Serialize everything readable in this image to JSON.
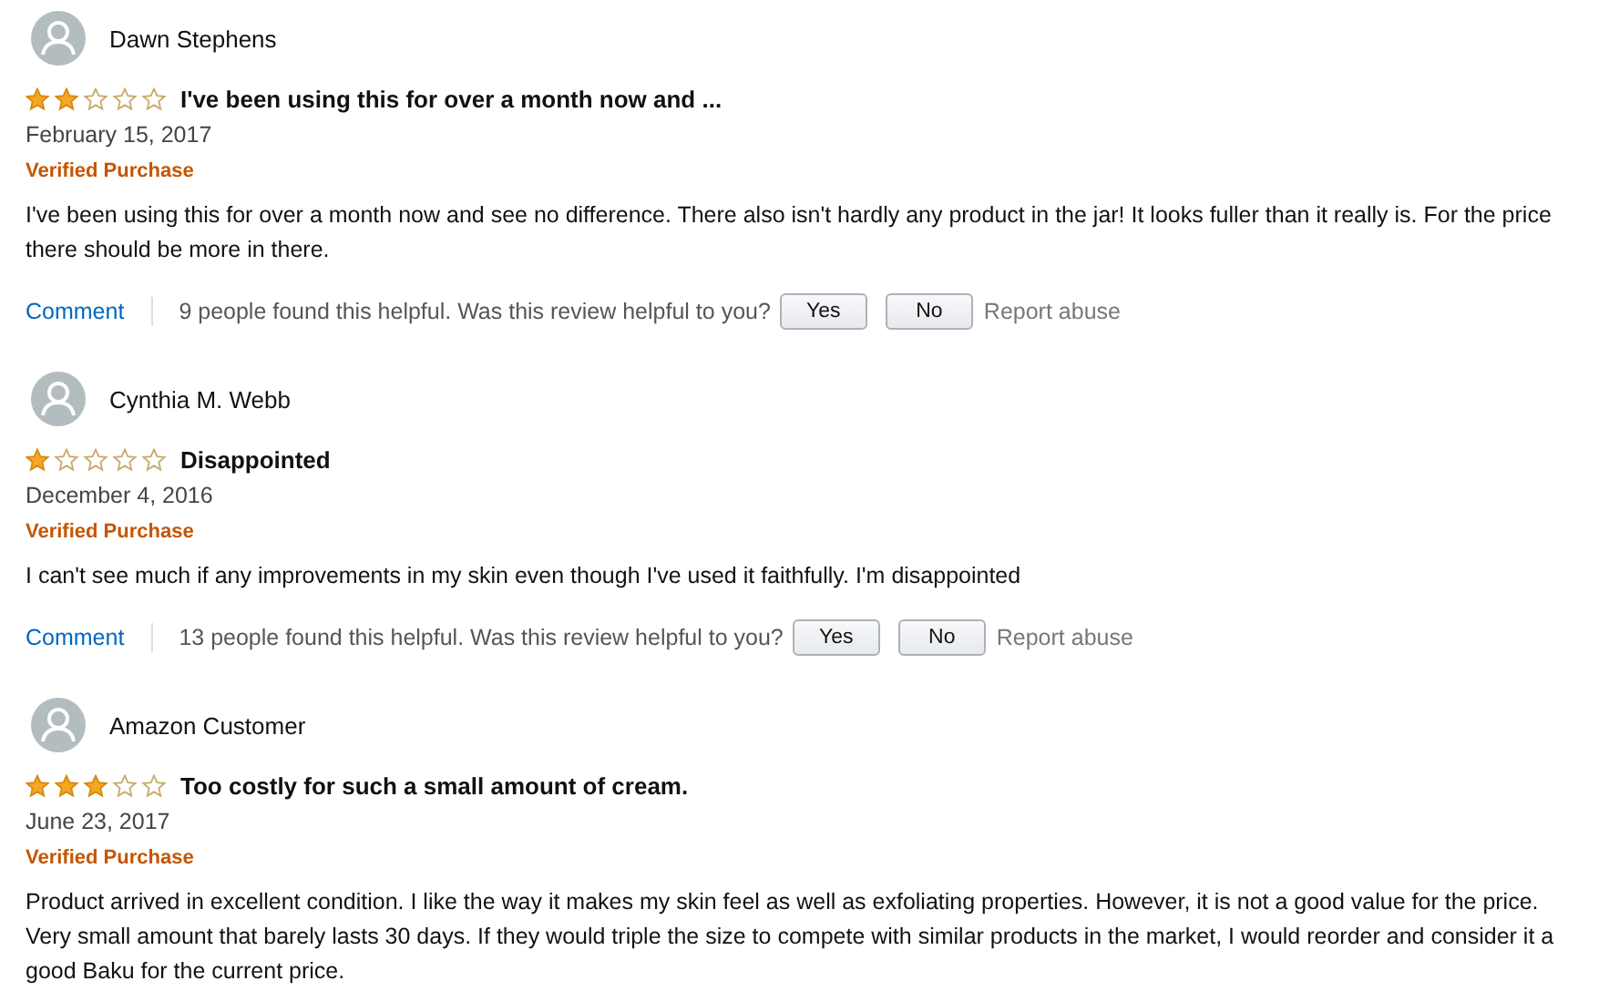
{
  "reviews": [
    {
      "author": "Dawn Stephens",
      "stars": 2,
      "title": "I've been using this for over a month now and ...",
      "date": "February 15, 2017",
      "badge": "Verified Purchase",
      "body": "I've been using this for over a month now and see no difference. There also isn't hardly any product in the jar! It looks fuller than it really is. For the price there should be more in there.",
      "comment": "Comment",
      "helpful": "9 people found this helpful. Was this review helpful to you?",
      "yes": "Yes",
      "no": "No",
      "report": "Report abuse"
    },
    {
      "author": "Cynthia M. Webb",
      "stars": 1,
      "title": "Disappointed",
      "date": "December 4, 2016",
      "badge": "Verified Purchase",
      "body": "I can't see much if any improvements in my skin even though I've used it faithfully. I'm disappointed",
      "comment": "Comment",
      "helpful": "13 people found this helpful. Was this review helpful to you?",
      "yes": "Yes",
      "no": "No",
      "report": "Report abuse"
    },
    {
      "author": "Amazon Customer",
      "stars": 3,
      "title": "Too costly for such a small amount of cream.",
      "date": "June 23, 2017",
      "badge": "Verified Purchase",
      "body": "Product arrived in excellent condition. I like the way it makes my skin feel as well as exfoliating properties. However, it is not a good value for the price. Very small amount that barely lasts 30 days. If they would triple the size to compete with similar products in the market, I would reorder and consider it a good Baku for the current price."
    }
  ]
}
